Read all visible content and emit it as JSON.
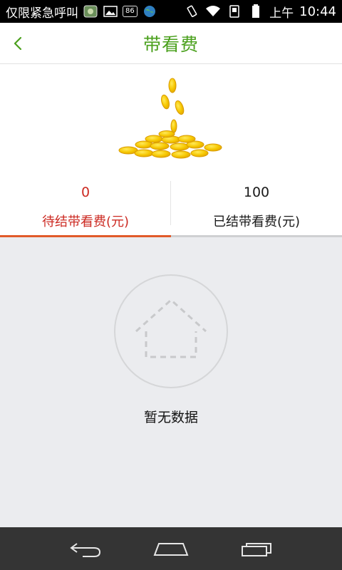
{
  "status_bar": {
    "carrier_text": "仅限紧急呼叫",
    "badge": "86",
    "ampm": "上午",
    "time": "10:44"
  },
  "header": {
    "title": "带看费"
  },
  "tabs": [
    {
      "value": "0",
      "label": "待结带看费(元)",
      "state": "active"
    },
    {
      "value": "100",
      "label": "已结带看费(元)",
      "state": "inactive"
    }
  ],
  "empty_state": {
    "text": "暂无数据"
  },
  "colors": {
    "title_green": "#4aa01c",
    "active_red": "#cc2a22",
    "indicator_orange": "#e15a2a",
    "content_bg": "#ebecef",
    "navbar_bg": "#343434"
  },
  "icons": {
    "back": "chevron-left-icon",
    "hero": "gold-coins-illustration",
    "empty": "empty-house-icon",
    "nav_back": "back-arrow-icon",
    "nav_home": "home-icon",
    "nav_recent": "recent-apps-icon"
  }
}
